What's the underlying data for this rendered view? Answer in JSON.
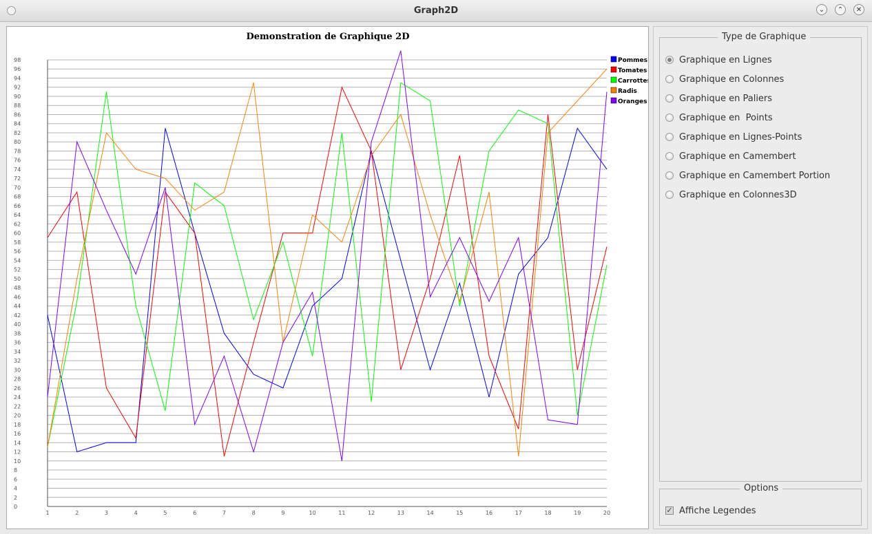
{
  "window": {
    "title": "Graph2D"
  },
  "chart_data": {
    "type": "line",
    "title": "Demonstration de Graphique 2D",
    "x": [
      1,
      2,
      3,
      4,
      5,
      6,
      7,
      8,
      9,
      10,
      11,
      12,
      13,
      14,
      15,
      16,
      17,
      18,
      19,
      20
    ],
    "ylim": [
      0,
      98
    ],
    "ytick_step": 2,
    "grid": true,
    "legend_position": "top-right",
    "series": [
      {
        "name": "Pommes",
        "color": "#0000ff",
        "values": [
          42,
          12,
          14,
          14,
          83,
          60,
          38,
          29,
          26,
          44,
          50,
          78,
          54,
          30,
          49,
          24,
          51,
          59,
          83,
          74
        ]
      },
      {
        "name": "Tomates",
        "color": "#ff0000",
        "values": [
          59,
          69,
          26,
          15,
          69,
          60,
          11,
          36,
          60,
          60,
          92,
          78,
          30,
          50,
          77,
          33,
          17,
          86,
          30,
          57
        ]
      },
      {
        "name": "Carrottes",
        "color": "#00ff00",
        "values": [
          13,
          45,
          91,
          44,
          21,
          71,
          66,
          41,
          58,
          33,
          82,
          23,
          93,
          89,
          44,
          78,
          87,
          84,
          20,
          53
        ]
      },
      {
        "name": "Radis",
        "color": "#ff8000",
        "values": [
          13,
          50,
          82,
          74,
          72,
          65,
          69,
          93,
          36,
          64,
          58,
          77,
          86,
          64,
          45,
          69,
          11,
          82,
          89,
          96
        ]
      },
      {
        "name": "Oranges",
        "color": "#8000ff",
        "values": [
          24,
          80,
          65,
          51,
          70,
          18,
          33,
          12,
          36,
          47,
          10,
          80,
          100,
          46,
          59,
          45,
          59,
          19,
          18,
          91
        ]
      }
    ]
  },
  "sidebar": {
    "chart_type_group": {
      "title": "Type de Graphique",
      "options": [
        {
          "label": "Graphique en Lignes",
          "checked": true
        },
        {
          "label": "Graphique en Colonnes",
          "checked": false
        },
        {
          "label": "Graphique en Paliers",
          "checked": false
        },
        {
          "label": "Graphique en  Points",
          "checked": false
        },
        {
          "label": "Graphique en Lignes-Points",
          "checked": false
        },
        {
          "label": "Graphique en Camembert",
          "checked": false
        },
        {
          "label": "Graphique en Camembert Portion",
          "checked": false
        },
        {
          "label": "Graphique en Colonnes3D",
          "checked": false
        }
      ]
    },
    "options_group": {
      "title": "Options",
      "show_legend": {
        "label": "Affiche Legendes",
        "checked": true
      }
    }
  }
}
